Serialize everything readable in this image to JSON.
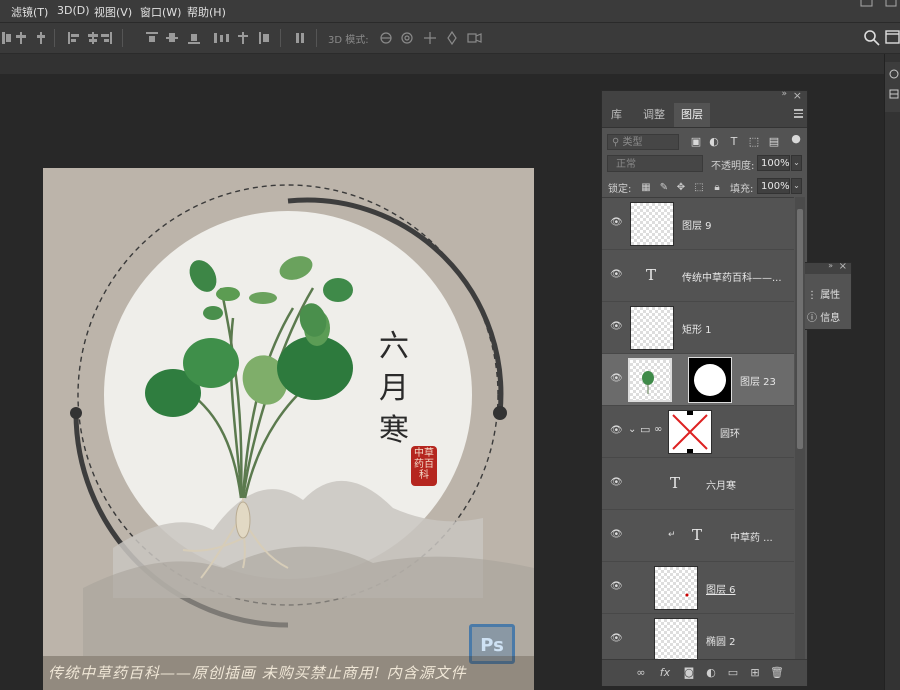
{
  "menu": [
    "滤镜(T)",
    "3D(D)",
    "视图(V)",
    "窗口(W)",
    "帮助(H)"
  ],
  "options": {
    "mode3d_label": "3D 模式:"
  },
  "document": {
    "vertical_title": [
      "六",
      "月",
      "寒"
    ],
    "seal_text": "中草药百科",
    "watermark": "传统中草药百科——原创插画 未购买禁止商用! 内含源文件",
    "logo_text": "Ps"
  },
  "layers_panel": {
    "tabs": [
      "库",
      "调整",
      "图层"
    ],
    "active_tab": "图层",
    "filter_placeholder": "类型",
    "blend_mode": "正常",
    "opacity_label": "不透明度:",
    "opacity_value": "100%",
    "lock_label": "锁定:",
    "fill_label": "填充:",
    "fill_value": "100%",
    "layers": [
      {
        "name": "图层 9",
        "kind": "pixel",
        "selected": false
      },
      {
        "name": "传统中草药百科——...",
        "kind": "text",
        "selected": false
      },
      {
        "name": "矩形 1",
        "kind": "shape",
        "selected": false
      },
      {
        "name": "图层 23",
        "kind": "masked",
        "selected": true
      },
      {
        "name": "圆环",
        "kind": "group",
        "selected": false
      },
      {
        "name": "六月寒",
        "kind": "text",
        "selected": false
      },
      {
        "name": "中草药 ...",
        "kind": "text-clipped",
        "selected": false
      },
      {
        "name": "图层 6",
        "kind": "pixel",
        "selected": false
      },
      {
        "name": "椭圆 2",
        "kind": "shape",
        "selected": false
      }
    ],
    "bottom_icons": [
      "link-icon",
      "fx-icon",
      "mask-icon",
      "adjustment-icon",
      "folder-icon",
      "new-layer-icon",
      "trash-icon"
    ]
  },
  "props_panel": {
    "items": [
      "属性",
      "信息"
    ]
  },
  "colors": {
    "selection": "#6b6b6b",
    "panel": "#535353",
    "seal": "#b5261f"
  }
}
